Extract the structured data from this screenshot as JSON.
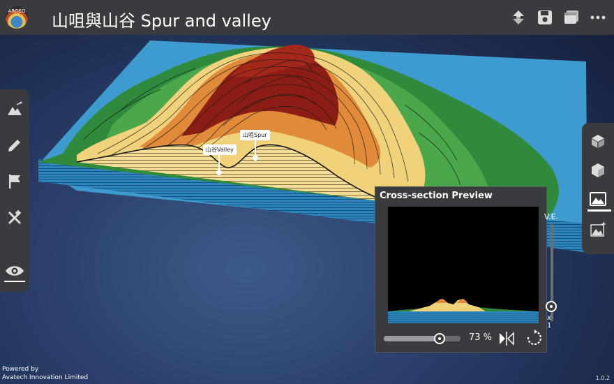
{
  "app": {
    "logo_text": "ARGEO",
    "title": "山咀與山谷 Spur and valley",
    "version": "1.0.2"
  },
  "toolbar": {
    "actions": [
      {
        "name": "upload-download-icon"
      },
      {
        "name": "save-icon"
      },
      {
        "name": "layers-icon"
      },
      {
        "name": "more-icon"
      }
    ]
  },
  "left_tools": [
    {
      "name": "terrain-tool-icon"
    },
    {
      "name": "pencil-icon"
    },
    {
      "name": "flag-icon"
    },
    {
      "name": "measure-tool-icon"
    },
    {
      "name": "eye-icon"
    }
  ],
  "right_tools": [
    {
      "name": "box-top-icon"
    },
    {
      "name": "cube-icon"
    },
    {
      "name": "cross-section-icon",
      "selected": true
    },
    {
      "name": "terrain-sparkle-icon"
    }
  ],
  "markers": {
    "spur": "山咀Spur",
    "valley": "山谷Valley"
  },
  "cross_section": {
    "title": "Cross-section Preview",
    "ve_label": "V.E.",
    "ve_value": "x 1",
    "opacity_percent": 73,
    "opacity_label": "73 %"
  },
  "footer": {
    "powered_by": "Powered by",
    "company": "Avatech Innovation Limited"
  },
  "colors": {
    "panel": "#3a3b3f",
    "water": "#2f8fc6",
    "lowland": "#2f8a3b",
    "sand": "#f0d27a",
    "mid": "#e08a3a",
    "peak": "#8b1d14"
  }
}
